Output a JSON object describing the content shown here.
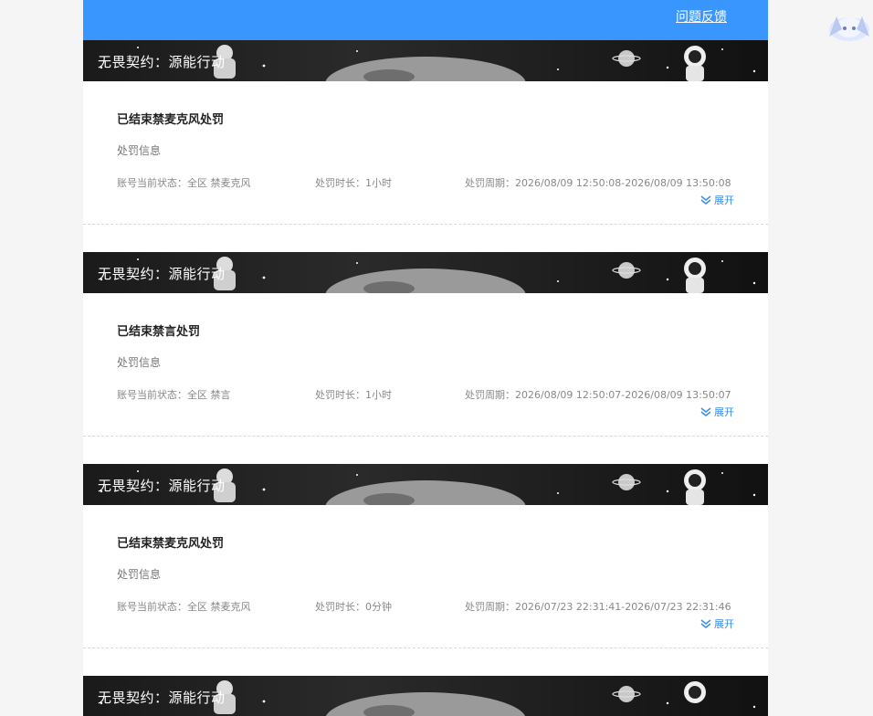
{
  "header": {
    "feedback_link": "问题反馈"
  },
  "records": [
    {
      "game": "无畏契约：源能行动",
      "title": "已结束禁麦克风处罚",
      "subtitle": "处罚信息",
      "status": "账号当前状态：全区 禁麦克风",
      "duration": "处罚时长：1小时",
      "period": "处罚周期：2026/08/09 12:50:08-2026/08/09 13:50:08",
      "expand": "展开"
    },
    {
      "game": "无畏契约：源能行动",
      "title": "已结束禁言处罚",
      "subtitle": "处罚信息",
      "status": "账号当前状态：全区 禁言",
      "duration": "处罚时长：1小时",
      "period": "处罚周期：2026/08/09 12:50:07-2026/08/09 13:50:07",
      "expand": "展开"
    },
    {
      "game": "无畏契约：源能行动",
      "title": "已结束禁麦克风处罚",
      "subtitle": "处罚信息",
      "status": "账号当前状态：全区 禁麦克风",
      "duration": "处罚时长：0分钟",
      "period": "处罚周期：2026/07/23 22:31:41-2026/07/23 22:31:46",
      "expand": "展开"
    },
    {
      "game": "无畏契约：源能行动"
    }
  ]
}
